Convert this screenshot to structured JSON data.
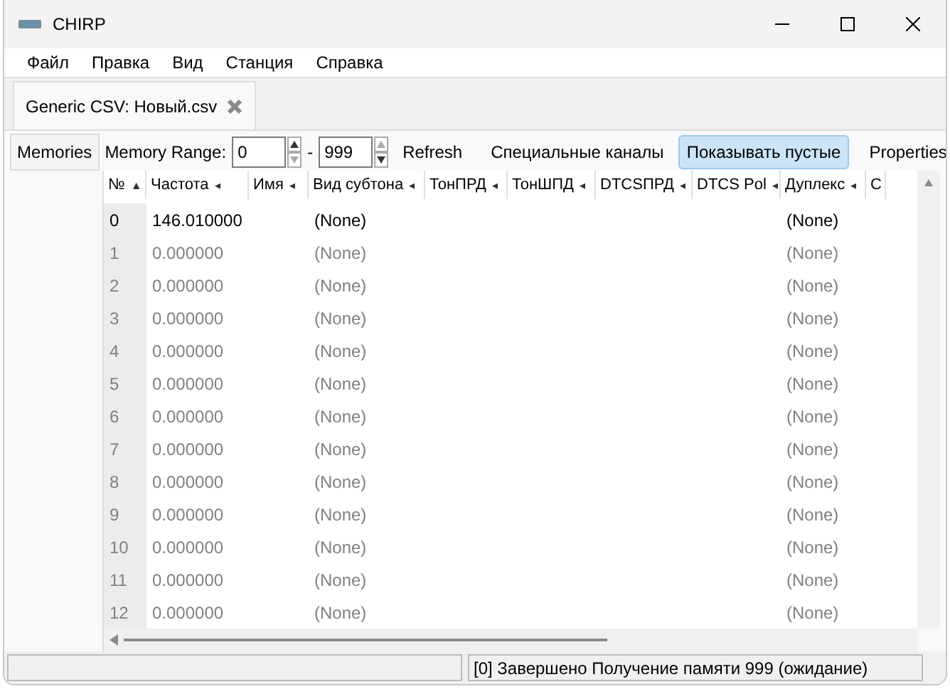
{
  "window": {
    "title": "CHIRP"
  },
  "menu": [
    "Файл",
    "Правка",
    "Вид",
    "Станция",
    "Справка"
  ],
  "tabs": [
    {
      "label": "Generic CSV: Новый.csv",
      "selected": true
    }
  ],
  "side_tab": {
    "label": "Memories"
  },
  "toolbar": {
    "range_label": "Memory Range:",
    "range_from": "0",
    "range_sep": "-",
    "range_to": "999",
    "refresh": "Refresh",
    "special": "Специальные каналы",
    "show_empty": {
      "label": "Показывать пустые",
      "selected": true
    },
    "properties": "Properties"
  },
  "table": {
    "columns": [
      {
        "label": "№",
        "sort_icon": "▲"
      },
      {
        "label": "Частота",
        "sort_icon": "◂"
      },
      {
        "label": "Имя",
        "sort_icon": "◂"
      },
      {
        "label": "Вид субтона",
        "sort_icon": "◂"
      },
      {
        "label": "ТонПРД",
        "sort_icon": "◂"
      },
      {
        "label": "ТонШПД",
        "sort_icon": "◂"
      },
      {
        "label": "DTCSПРД",
        "sort_icon": "◂"
      },
      {
        "label": "DTCS Pol",
        "sort_icon": "◂"
      },
      {
        "label": "Дуплекс",
        "sort_icon": "◂"
      },
      {
        "label": "С"
      }
    ],
    "rows": [
      {
        "cells": [
          "0",
          "146.010000",
          "",
          "(None)",
          "",
          "",
          "",
          "",
          "(None)",
          ""
        ],
        "empty": false
      },
      {
        "cells": [
          "1",
          "0.000000",
          "",
          "(None)",
          "",
          "",
          "",
          "",
          "(None)",
          ""
        ],
        "empty": true
      },
      {
        "cells": [
          "2",
          "0.000000",
          "",
          "(None)",
          "",
          "",
          "",
          "",
          "(None)",
          ""
        ],
        "empty": true
      },
      {
        "cells": [
          "3",
          "0.000000",
          "",
          "(None)",
          "",
          "",
          "",
          "",
          "(None)",
          ""
        ],
        "empty": true
      },
      {
        "cells": [
          "4",
          "0.000000",
          "",
          "(None)",
          "",
          "",
          "",
          "",
          "(None)",
          ""
        ],
        "empty": true
      },
      {
        "cells": [
          "5",
          "0.000000",
          "",
          "(None)",
          "",
          "",
          "",
          "",
          "(None)",
          ""
        ],
        "empty": true
      },
      {
        "cells": [
          "6",
          "0.000000",
          "",
          "(None)",
          "",
          "",
          "",
          "",
          "(None)",
          ""
        ],
        "empty": true
      },
      {
        "cells": [
          "7",
          "0.000000",
          "",
          "(None)",
          "",
          "",
          "",
          "",
          "(None)",
          ""
        ],
        "empty": true
      },
      {
        "cells": [
          "8",
          "0.000000",
          "",
          "(None)",
          "",
          "",
          "",
          "",
          "(None)",
          ""
        ],
        "empty": true
      },
      {
        "cells": [
          "9",
          "0.000000",
          "",
          "(None)",
          "",
          "",
          "",
          "",
          "(None)",
          ""
        ],
        "empty": true
      },
      {
        "cells": [
          "10",
          "0.000000",
          "",
          "(None)",
          "",
          "",
          "",
          "",
          "(None)",
          ""
        ],
        "empty": true
      },
      {
        "cells": [
          "11",
          "0.000000",
          "",
          "(None)",
          "",
          "",
          "",
          "",
          "(None)",
          ""
        ],
        "empty": true
      },
      {
        "cells": [
          "12",
          "0.000000",
          "",
          "(None)",
          "",
          "",
          "",
          "",
          "(None)",
          ""
        ],
        "empty": true
      }
    ]
  },
  "status_bar": {
    "message": "[0] Завершено Получение памяти 999 (ожидание)"
  }
}
